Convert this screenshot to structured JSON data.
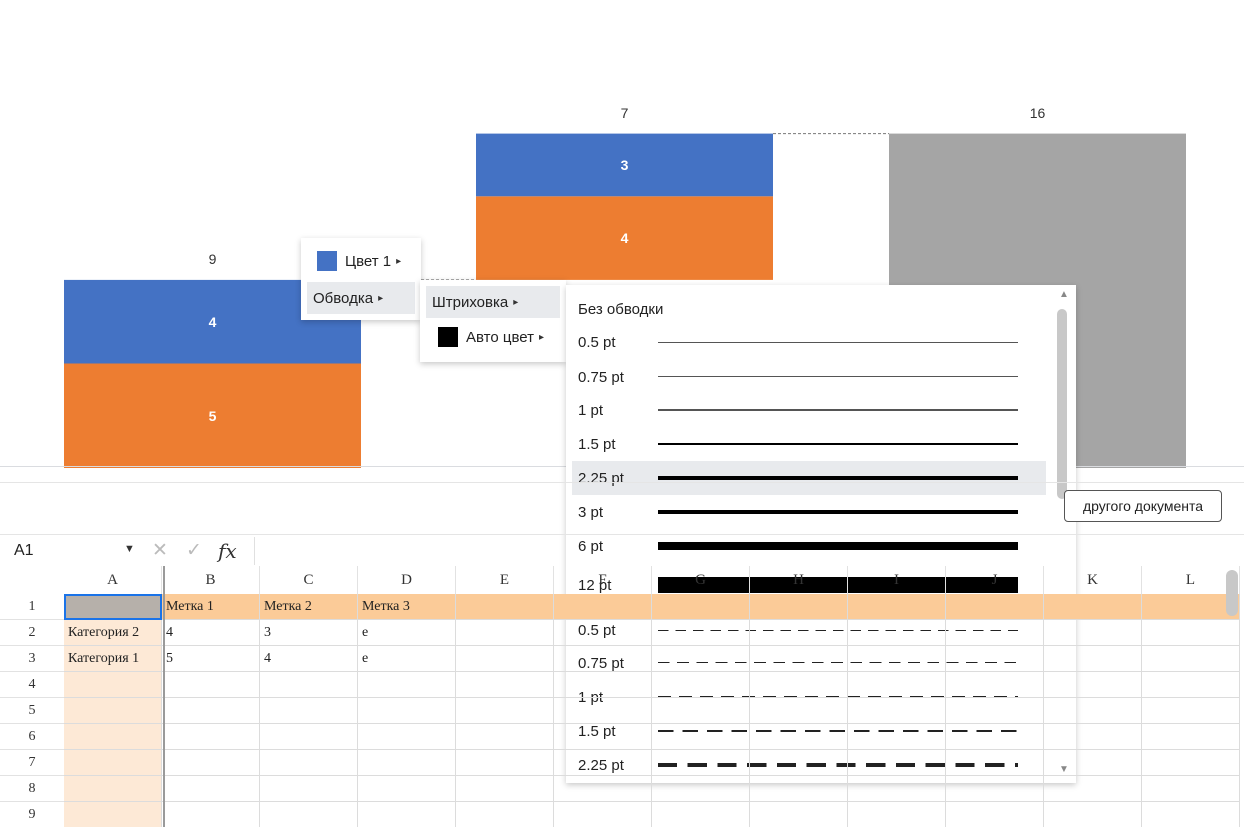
{
  "chart_data": {
    "type": "bar",
    "categories": [
      "",
      "",
      ""
    ],
    "series": [
      {
        "values": [
          5,
          4,
          null
        ]
      },
      {
        "values": [
          4,
          3,
          null
        ]
      },
      {
        "values": [
          null,
          null,
          16
        ]
      }
    ],
    "totals": [
      9,
      7,
      16
    ],
    "colors": {
      "series_a": "#ED7D31",
      "series_b": "#4472C4",
      "total": "#A5A5A5"
    }
  },
  "context_menu": {
    "color_label": "Цвет 1",
    "color_swatch": "#4472C4",
    "outline_label": "Обводка"
  },
  "outline_submenu": {
    "hatch_label": "Штриховка",
    "auto_color_label": "Авто цвет",
    "auto_color_swatch": "#000000"
  },
  "line_weights": {
    "none_label": "Без обводки",
    "items": [
      {
        "label": "0.5 pt",
        "weight": 0.5,
        "dashed": false
      },
      {
        "label": "0.75 pt",
        "weight": 0.75,
        "dashed": false
      },
      {
        "label": "1 pt",
        "weight": 1,
        "dashed": false
      },
      {
        "label": "1.5 pt",
        "weight": 1.5,
        "dashed": false
      },
      {
        "label": "2.25 pt",
        "weight": 2.25,
        "dashed": false,
        "selected": true
      },
      {
        "label": "3 pt",
        "weight": 3,
        "dashed": false
      },
      {
        "label": "6 pt",
        "weight": 6,
        "dashed": false
      },
      {
        "label": "12 pt",
        "weight": 12,
        "dashed": false
      },
      {
        "label": "0.5 pt",
        "weight": 0.5,
        "dashed": true
      },
      {
        "label": "0.75 pt",
        "weight": 0.75,
        "dashed": true
      },
      {
        "label": "1 pt",
        "weight": 1,
        "dashed": true
      },
      {
        "label": "1.5 pt",
        "weight": 1.5,
        "dashed": true
      },
      {
        "label": "2.25 pt",
        "weight": 2.25,
        "dashed": true
      }
    ]
  },
  "toolbar": {
    "other_doc_label": "другого документа"
  },
  "formula_bar": {
    "cell_ref": "A1",
    "fx_label": "fx"
  },
  "sheet": {
    "columns": [
      "A",
      "B",
      "C",
      "D",
      "E",
      "F",
      "G",
      "H",
      "I",
      "J",
      "K",
      "L"
    ],
    "rows": [
      "1",
      "2",
      "3",
      "4",
      "5",
      "6",
      "7",
      "8",
      "9"
    ],
    "cells": [
      [
        "",
        "Метка 1",
        "Метка 2",
        "Метка 3"
      ],
      [
        "Категория 2",
        "4",
        "3",
        "e"
      ],
      [
        "Категория 1",
        "5",
        "4",
        "e"
      ]
    ]
  }
}
